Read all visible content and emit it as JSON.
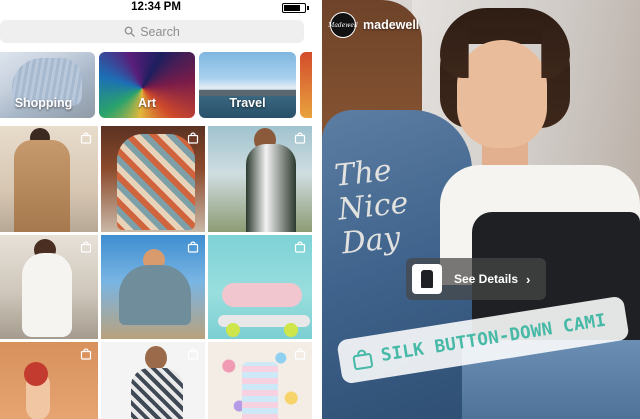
{
  "explore": {
    "status_bar": {
      "time": "12:34 PM",
      "battery_level": 0.85
    },
    "search": {
      "placeholder": "Search",
      "icon": "search-icon"
    },
    "categories": [
      {
        "label": "Shopping"
      },
      {
        "label": "Art"
      },
      {
        "label": "Travel"
      }
    ],
    "grid_icon": "shopping-bag-icon",
    "grid_tiles": 9
  },
  "story": {
    "username": "madewell",
    "avatar_text": "Madewell",
    "jacket_script": "The\nNice\nDay",
    "details_button": {
      "label": "See Details",
      "icon": "chevron-right-icon"
    },
    "product_tag": {
      "label": "SILK BUTTON-DOWN CAMI",
      "icon": "shopping-bag-icon",
      "color": "#47b9a7"
    }
  }
}
